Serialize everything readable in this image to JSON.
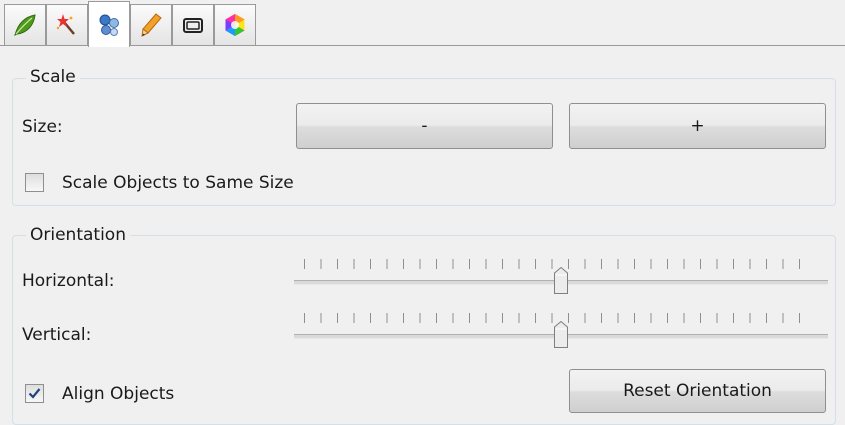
{
  "tabs": [
    {
      "icon": "leaf-icon",
      "active": false
    },
    {
      "icon": "magic-wand-icon",
      "active": false
    },
    {
      "icon": "objects-icon",
      "active": true
    },
    {
      "icon": "pencil-icon",
      "active": false
    },
    {
      "icon": "frame-icon",
      "active": false
    },
    {
      "icon": "color-wheel-icon",
      "active": false
    }
  ],
  "scale": {
    "title": "Scale",
    "size_label": "Size:",
    "minus_label": "-",
    "plus_label": "+",
    "same_size_label": "Scale Objects to Same Size",
    "same_size_checked": false
  },
  "orientation": {
    "title": "Orientation",
    "horizontal_label": "Horizontal:",
    "horizontal_value": 0.5,
    "vertical_label": "Vertical:",
    "vertical_value": 0.5,
    "align_label": "Align Objects",
    "align_checked": true,
    "reset_label": "Reset Orientation"
  }
}
